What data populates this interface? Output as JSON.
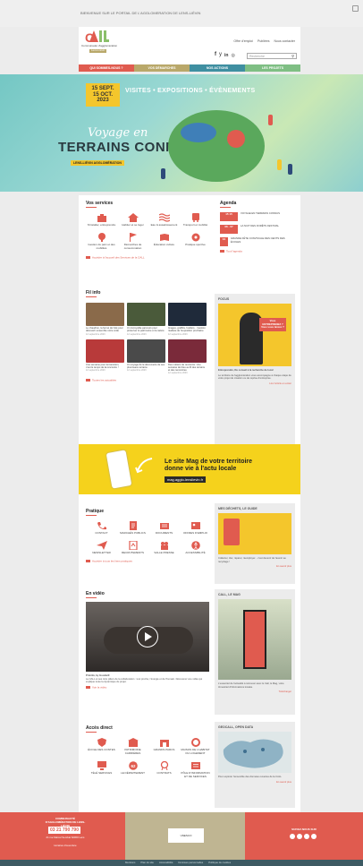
{
  "topbar": {
    "welcome": "BIENVENUE SUR LE PORTAIL DE L'AGGLOMERATION DE LENS-LIÉVIN"
  },
  "logo": {
    "line1": "CALL",
    "line2": "Communauté d'agglomération",
    "line3": "Lens-Liévin"
  },
  "top_links": [
    "Offre d'emploi",
    "Publiées",
    "Nous contacter"
  ],
  "social": [
    "f",
    "y",
    "in",
    "◎"
  ],
  "search": {
    "placeholder": "Recherche"
  },
  "nav": [
    {
      "label": "QUI SOMMES-NOUS ?",
      "color": "#e05b4f"
    },
    {
      "label": "VOS DÉMARCHES",
      "color": "#b9a86a"
    },
    {
      "label": "NOS ACTIONS",
      "color": "#3f8fa1"
    },
    {
      "label": "LES PROJETS",
      "color": "#7fbf84"
    }
  ],
  "hero": {
    "date1": "15 SEPT.",
    "date2": "15 OCT.",
    "year": "2023",
    "events": "VISITES • EXPOSITIONS • ÉVÈNEMENTS",
    "title1": "Voyage en",
    "title2": "TERRAINS CONNUS",
    "tag": "LENS-LIÉVIN AGGLOMÉRATION"
  },
  "services": {
    "title": "Vos services",
    "items": [
      {
        "label": "S'installer, entreprendre",
        "icon": "business-icon"
      },
      {
        "label": "Habiter et se loger",
        "icon": "house-icon"
      },
      {
        "label": "Eau & assainissement",
        "icon": "water-icon"
      },
      {
        "label": "Transport et mobilité",
        "icon": "bus-icon"
      },
      {
        "label": "Gestion du parc et des mobilités",
        "icon": "tree-icon"
      },
      {
        "label": "Démarches de consommation",
        "icon": "flag-icon"
      },
      {
        "label": "Éducation culture",
        "icon": "book-icon"
      },
      {
        "label": "Pratique sportive",
        "icon": "ball-icon"
      }
    ],
    "more": "Accéder à l'accueil des Services de la CALL"
  },
  "agenda": {
    "title": "Agenda",
    "items": [
      {
        "date": "15 15",
        "text": "VOYAGE EN TERRAINS CONNUS"
      },
      {
        "date": "06 - 07",
        "text": "LA NUIT DES FORÊTS FESTIVAL"
      },
      {
        "date": "04",
        "text": "GRANDE FÊTE CONVIVIALE DES CENTS DES ÉCOLES"
      }
    ],
    "more": "Tout l'agenda"
  },
  "news": {
    "title": "Fil info",
    "items": [
      {
        "caption": "Le chaudron, la fermé de l'été pour découvrir ensemble notre code",
        "date": "12 septembre 2023",
        "color": "#8a6a4a"
      },
      {
        "caption": "Un incroyable parcours pour préserver le patrimoine et la nature",
        "date": "12 septembre 2023",
        "color": "#4a5a3a"
      },
      {
        "caption": "Images, graffitis, fusiliers... Gestion réalisée de l'exposition prochaine",
        "date": "12 septembre 2023",
        "color": "#1f2a3a"
      },
      {
        "caption": "Une semaine pour la transition, c'est le temps de la rencontre !",
        "date": "12 septembre 2023",
        "color": "#b83a3a"
      },
      {
        "caption": "Un voyage de la découverte de ses plus beaux terrains",
        "date": "12 septembre 2023",
        "color": "#4a4a4a"
      },
      {
        "caption": "Des métiers de rencontre. Une semaine de bleu au fil des terrains et des rencontres",
        "date": "12 septembre 2023",
        "color": "#7a2a3a"
      }
    ],
    "more": "Toutes les actualités"
  },
  "focus": {
    "title": "FOCUS",
    "bubble": "Vous ENTREPRENEZ ? Vous vous lancez ?",
    "heading": "Entreprendre, Du conseil à la recherche de local",
    "text": "Le territoire de l'agglomération vous accompagne à chaque étape de votre projet de création ou de reprise d'entreprise.",
    "more": "Lire l'article en entier"
  },
  "banner": {
    "text1": "Le site Mag de votre territoire",
    "text2": "donne vie à l'actu locale",
    "url": "mag.agglo-lenslievin.fr"
  },
  "pratique": {
    "title": "Pratique",
    "items": [
      {
        "label": "CONTACT",
        "icon": "phone-icon"
      },
      {
        "label": "MARCHÉS PUBLICS",
        "icon": "doc-icon"
      },
      {
        "label": "DOCUMENTS",
        "icon": "folder-icon"
      },
      {
        "label": "OFFRES D'EMPLOI",
        "icon": "id-icon"
      },
      {
        "label": "NEWSLETTER",
        "icon": "send-icon"
      },
      {
        "label": "RECRUTEMENTS",
        "icon": "file-icon"
      },
      {
        "label": "SALLE PRESSE",
        "icon": "people-icon"
      },
      {
        "label": "ACCESSIBILITÉ",
        "icon": "access-icon"
      }
    ],
    "more": "Accéder à tous les liens pratiques"
  },
  "dechets": {
    "title": "MES DÉCHETS, LE GUIDE",
    "text": "Collecter, trier, réparer, réemployer... c'est devenir de l'avenir au recyclage !",
    "more": "En savoir plus"
  },
  "video": {
    "title": "En vidéo",
    "caption_title": "Primitiv, by Goodwill",
    "caption": "La CALL et ses trois piliers de la collaboration : tout proche, l'énergie et de l'humain. Découvrez une vidéo qui explique toute la dynamique du projet.",
    "more": "Voir la vidéo"
  },
  "mag": {
    "title": "CALL, LE MAG",
    "text": "L'essentiel de l'actualité à retrouver avec le Call, le Mag, votre trimestriel d'informations locales.",
    "more": "Télécharger"
  },
  "acces": {
    "title": "Accès direct",
    "items": [
      {
        "label": "ÉCOLE DES CONTES",
        "icon": "shield-icon"
      },
      {
        "label": "PATRIMOINE CARRIÈRES",
        "icon": "building-icon"
      },
      {
        "label": "GRANDS PARCS",
        "icon": "park-icon"
      },
      {
        "label": "MAISON DE L'HABITAT DU LOGEMENT",
        "icon": "cycle-icon"
      },
      {
        "label": "TÉLÉ SERVICES",
        "icon": "screen-icon"
      },
      {
        "label": "LE DÉPARTEMENT",
        "icon": "badge-icon"
      },
      {
        "label": "CONTRATS",
        "icon": "award-icon"
      },
      {
        "label": "PÔLE D'INFORMATION ET DE SERVICES",
        "icon": "list-icon"
      }
    ]
  },
  "opendata": {
    "title": "GEOCALL, OPEN DATA",
    "text": "Pour explorer l'ensemble des données ouvertes de la CALL",
    "more": "En savoir plus"
  },
  "footer": {
    "org": "COMMUNAUTÉ D'AGGLOMÉRATION DE LENS-LIÉVIN",
    "phone": "03 21 790 790",
    "address": "21 rue Marcel Sembat 62300 Lens",
    "hours": "Horaires d'ouverture",
    "unesco": "UNESCO",
    "follow": "SUIVEZ-NOUS SUR"
  },
  "bottom_links": [
    "Mentions",
    "Plan du site",
    "Accessibilité",
    "Données personnelles",
    "Politique de cookies"
  ]
}
